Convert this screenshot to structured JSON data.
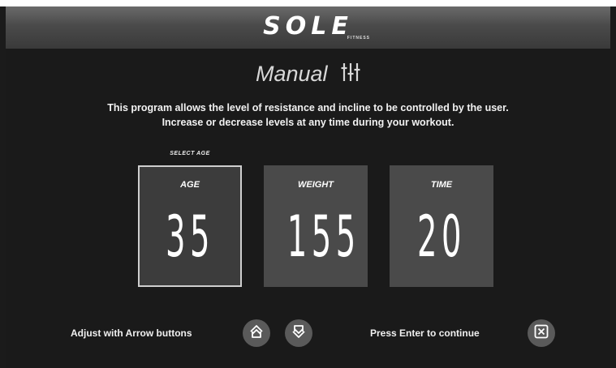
{
  "brand": {
    "logo_text": "SOLE",
    "logo_sub": "FITNESS"
  },
  "program": {
    "title": "Manual",
    "title_icon": "sliders-icon",
    "description_line1": "This program allows the level of resistance and incline to be controlled by the user.",
    "description_line2": "Increase or decrease levels at any time during your workout."
  },
  "selector": {
    "prompt": "SELECT AGE",
    "tiles": [
      {
        "label": "AGE",
        "value": "35",
        "selected": true
      },
      {
        "label": "WEIGHT",
        "value": "155",
        "selected": false
      },
      {
        "label": "TIME",
        "value": "20",
        "selected": false
      }
    ]
  },
  "footer": {
    "adjust_hint": "Adjust with Arrow buttons",
    "up_icon": "arrow-up-icon",
    "down_icon": "arrow-down-icon",
    "enter_hint": "Press Enter to continue",
    "enter_icon": "enter-x-icon"
  },
  "colors": {
    "background": "#1b1b1b",
    "tile": "#4a4a4a",
    "button": "#5a5a5a",
    "text": "#ffffff"
  }
}
